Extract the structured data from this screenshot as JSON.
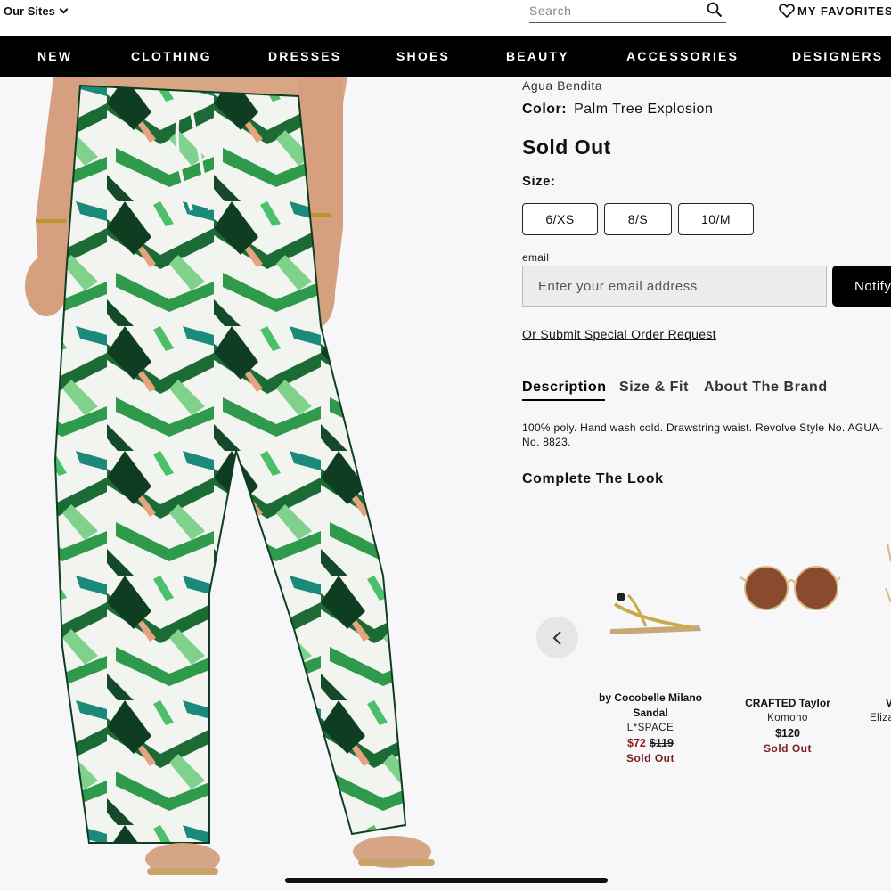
{
  "header": {
    "our_sites": "Our Sites",
    "search_placeholder": "Search",
    "favorites": "MY FAVORITES"
  },
  "nav": [
    "NEW",
    "CLOTHING",
    "DRESSES",
    "SHOES",
    "BEAUTY",
    "ACCESSORIES",
    "DESIGNERS"
  ],
  "product": {
    "brand": "Agua Bendita",
    "color_label": "Color:",
    "color_value": "Palm Tree Explosion",
    "status": "Sold Out",
    "size_label": "Size:",
    "sizes": [
      "6/XS",
      "8/S",
      "10/M"
    ]
  },
  "notify": {
    "email_label": "email",
    "email_placeholder": "Enter your email address",
    "button": "Notify",
    "special_order": "Or Submit Special Order Request"
  },
  "tabs": {
    "description": "Description",
    "size_fit": "Size & Fit",
    "about_brand": "About The Brand"
  },
  "description": {
    "line1": "100% poly. Hand wash cold. Drawstring waist. Revolve Style No. AGUA-",
    "line2": "No. 8823."
  },
  "complete_look": {
    "title": "Complete The Look",
    "items": [
      {
        "name_line1": "by Cocobelle Milano",
        "name_line2": "Sandal",
        "designer": "L*SPACE",
        "sale_price": "$72",
        "orig_price": "$119",
        "status": "Sold Out"
      },
      {
        "name_line1": "CRAFTED Taylor",
        "designer": "Komono",
        "price": "$120",
        "status": "Sold Out"
      },
      {
        "name_line1": "V",
        "designer": "Eliza"
      }
    ]
  },
  "colors": {
    "nav_bg": "#000000",
    "sold_out_red": "#7a1f1f",
    "palm_green": "#1f8a3a"
  }
}
